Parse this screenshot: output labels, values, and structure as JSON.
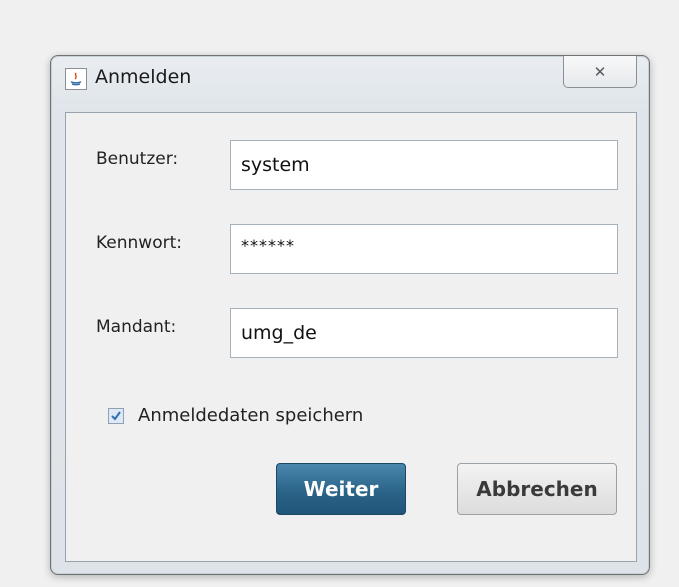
{
  "window": {
    "title": "Anmelden",
    "close_glyph": "✕"
  },
  "form": {
    "user": {
      "label": "Benutzer:",
      "value": "system"
    },
    "password": {
      "label": "Kennwort:",
      "value": "******"
    },
    "client": {
      "label": "Mandant:",
      "value": "umg_de"
    },
    "remember": {
      "label": "Anmeldedaten speichern",
      "checked": true
    }
  },
  "buttons": {
    "continue_label": "Weiter",
    "cancel_label": "Abbrechen"
  },
  "colors": {
    "primary_button": "#2b6489",
    "checkbox_check": "#2e6fb0"
  },
  "icons": {
    "app": "java-app-icon",
    "close": "close-icon",
    "check": "checkmark-icon"
  }
}
